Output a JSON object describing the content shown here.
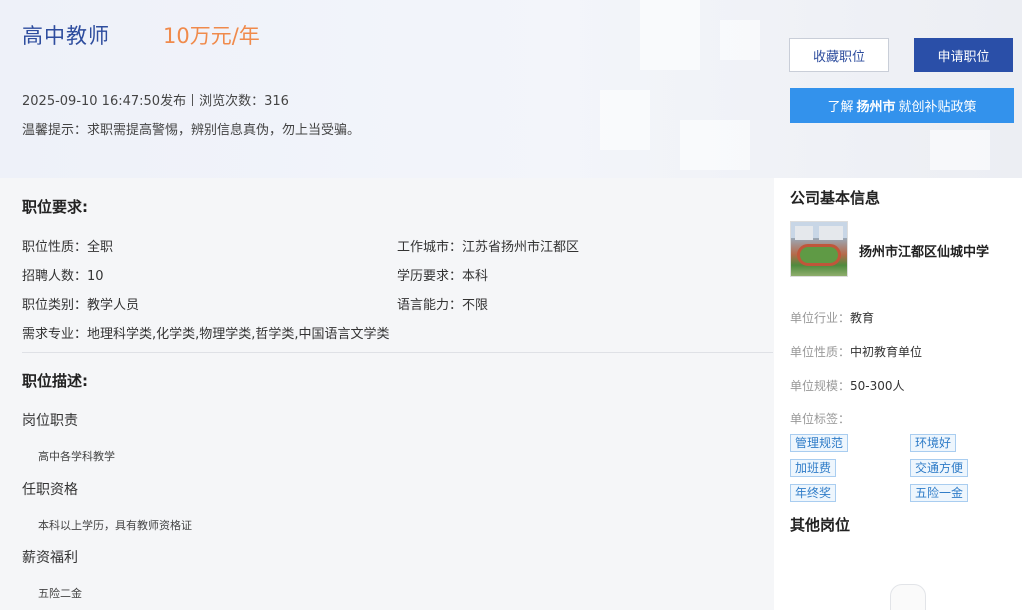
{
  "header": {
    "job_title": "高中教师",
    "salary": "10万元/年",
    "publish_time": "2025-09-10 16:47:50发布",
    "views_label": "浏览次数：316",
    "tip": "温馨提示：求职需提高警惕，辨别信息真伪，勿上当受骗。",
    "collect_label": "收藏职位",
    "apply_label": "申请职位",
    "policy": {
      "prefix": "了解",
      "city": "扬州市",
      "suffix": "就创补贴政策"
    }
  },
  "requirements": {
    "title": "职位要求:",
    "left": [
      "职位性质：全职",
      "招聘人数：10",
      "职位类别：教学人员"
    ],
    "right": [
      "工作城市：江苏省扬州市江都区",
      "学历要求：本科",
      "语言能力：不限"
    ],
    "major": "需求专业：地理科学类,化学类,物理学类,哲学类,中国语言文学类"
  },
  "description": {
    "title": "职位描述:",
    "sections": [
      {
        "heading": "岗位职责",
        "text": "高中各学科教学"
      },
      {
        "heading": "任职资格",
        "text": "本科以上学历，具有教师资格证"
      },
      {
        "heading": "薪资福利",
        "text": "五险二金"
      }
    ]
  },
  "company": {
    "title": "公司基本信息",
    "name": "扬州市江都区仙城中学",
    "industry_label": "单位行业：",
    "industry": "教育",
    "nature_label": "单位性质：",
    "nature": "中初教育单位",
    "scale_label": "单位规模：",
    "scale": "50-300人",
    "tags_label": "单位标签：",
    "tags": [
      "管理规范",
      "环境好",
      "加班费",
      "交通方便",
      "年终奖",
      "五险一金"
    ]
  },
  "other_jobs": {
    "title": "其他岗位"
  },
  "colors": {
    "title_blue": "#2e4d9e",
    "salary_orange": "#f08a4b",
    "apply_blue": "#2a4fa8",
    "policy_blue": "#3392ec",
    "tag_blue": "#2f7cc8"
  }
}
